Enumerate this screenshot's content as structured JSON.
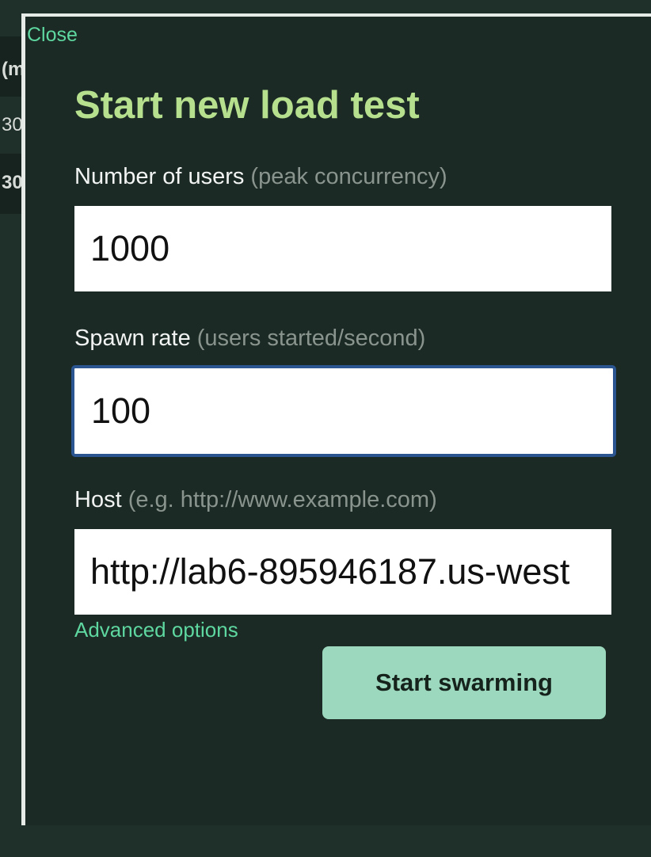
{
  "background_table": {
    "rows": [
      "(m",
      "30",
      "30"
    ]
  },
  "modal": {
    "close_label": "Close",
    "title": "Start new load test",
    "fields": {
      "users": {
        "label": "Number of users",
        "hint": "(peak concurrency)",
        "value": "1000"
      },
      "spawn_rate": {
        "label": "Spawn rate",
        "hint": "(users started/second)",
        "value": "100"
      },
      "host": {
        "label": "Host",
        "hint": "(e.g. http://www.example.com)",
        "value": "http://lab6-895946187.us-west"
      }
    },
    "advanced_options_label": "Advanced options",
    "submit_label": "Start swarming"
  },
  "colors": {
    "page_background": "#1f302a",
    "modal_background": "#1b2a24",
    "title": "#b6df8e",
    "link": "#5ed7a0",
    "button": "#9cd8bd",
    "focus_border": "#2a5591"
  }
}
